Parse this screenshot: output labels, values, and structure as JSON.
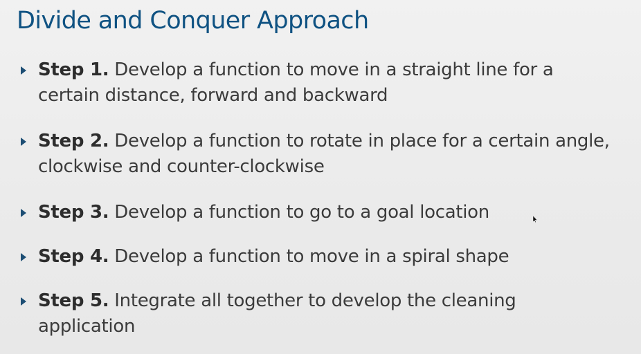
{
  "slide": {
    "title": "Divide and Conquer Approach",
    "bullets": [
      {
        "label": "Step 1.",
        "line1": " Develop a function to move in a straight line for a",
        "line2": "certain distance, forward and backward"
      },
      {
        "label": "Step 2.",
        "line1": " Develop a function to rotate in place for a certain angle,",
        "line2": "clockwise and counter-clockwise"
      },
      {
        "label": "Step 3.",
        "line1": " Develop a function to go to a goal location",
        "line2": ""
      },
      {
        "label": "Step 4.",
        "line1": " Develop a function to move in a spiral shape",
        "line2": ""
      },
      {
        "label": "Step 5.",
        "line1": " Integrate all together to develop the cleaning",
        "line2": "application"
      }
    ]
  },
  "colors": {
    "title": "#0f5282",
    "marker": "#1d4e74",
    "body_text": "#3b3b3b",
    "background": "#ececec"
  },
  "icons": {
    "bullet": "triangle-bullet-icon",
    "pointer": "mouse-pointer-icon"
  }
}
